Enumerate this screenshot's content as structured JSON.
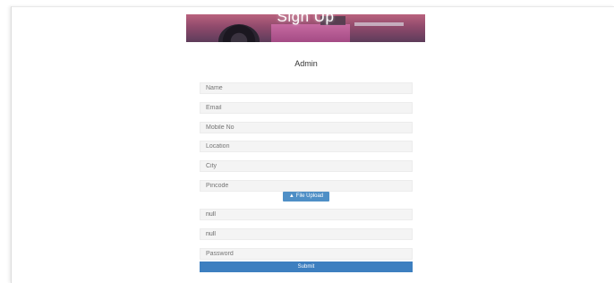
{
  "banner": {
    "title": "Sign Up"
  },
  "form": {
    "heading": "Admin",
    "fields": [
      {
        "placeholder": "Name",
        "value": ""
      },
      {
        "placeholder": "Email",
        "value": ""
      },
      {
        "placeholder": "Mobile No",
        "value": ""
      },
      {
        "placeholder": "Location",
        "value": ""
      },
      {
        "placeholder": "City",
        "value": ""
      },
      {
        "placeholder": "Pincode",
        "value": ""
      }
    ],
    "upload_label": "File Upload",
    "upload_icon": "upload-icon",
    "username_value": "null",
    "user_field_value": "null",
    "password_placeholder": "Password",
    "submit_label": "Submit"
  }
}
